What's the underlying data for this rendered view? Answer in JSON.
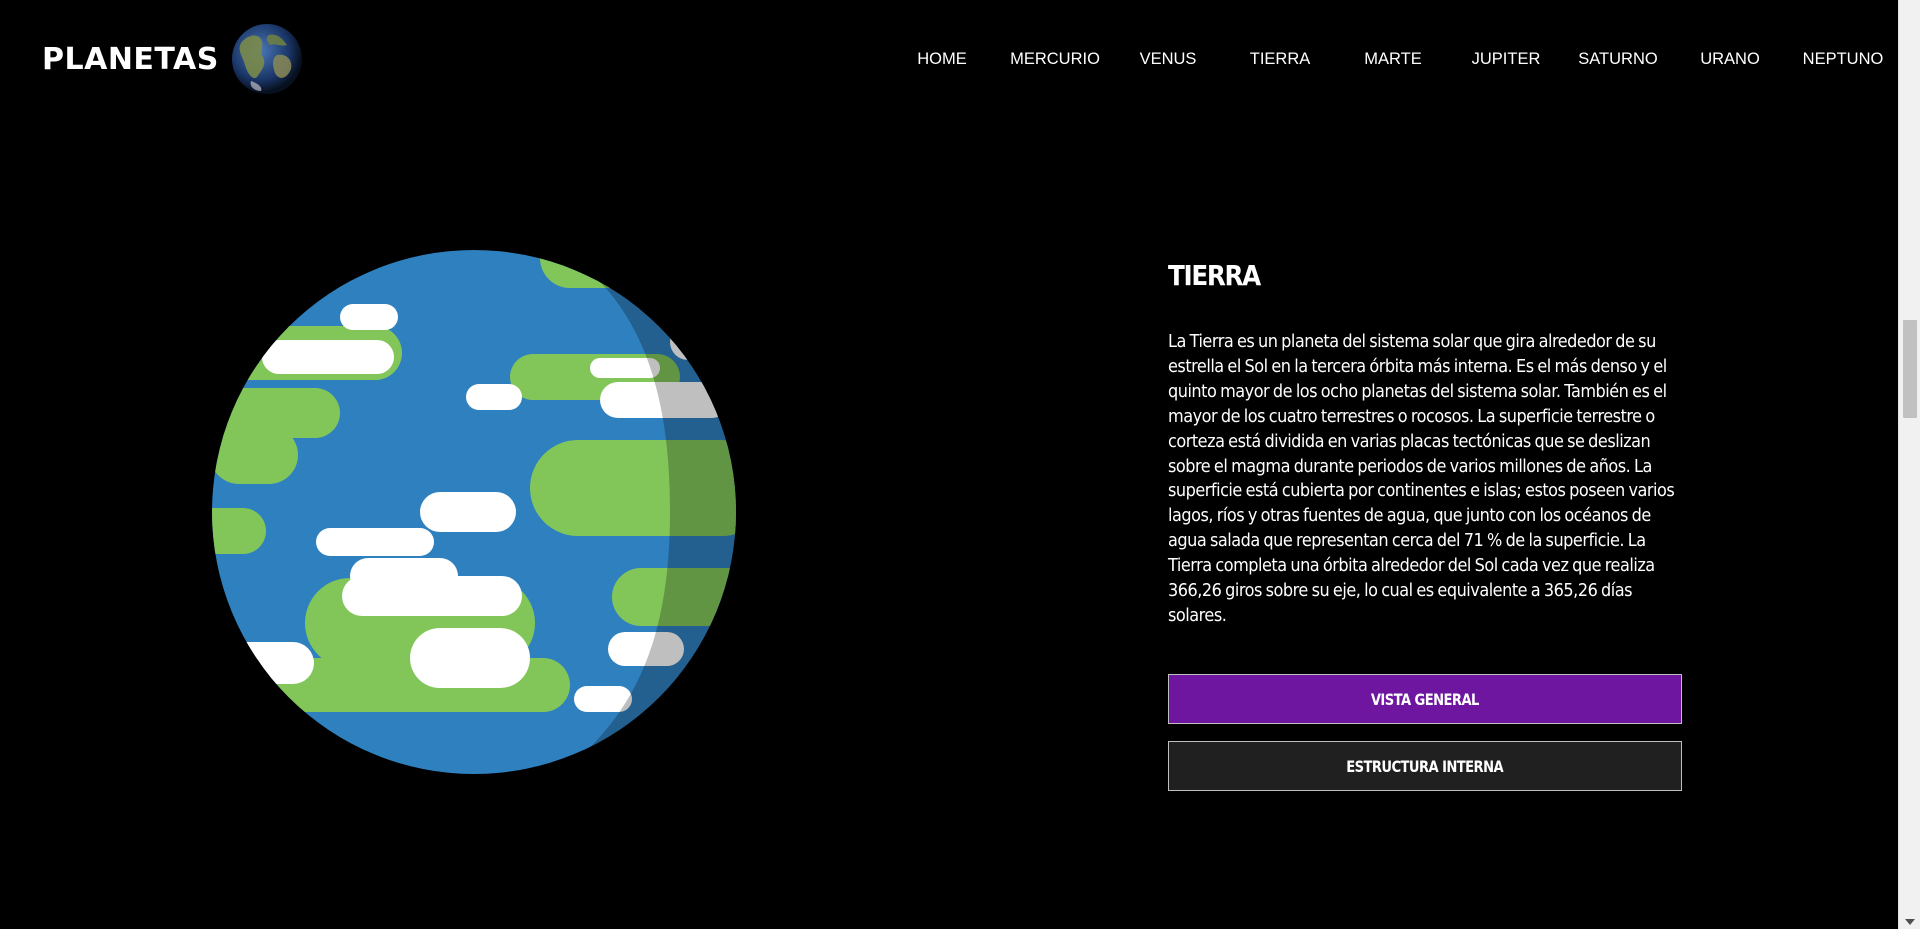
{
  "brand": {
    "title": "PLANETAS",
    "logo_icon": "earth-globe-icon"
  },
  "nav": {
    "items": [
      "HOME",
      "MERCURIO",
      "VENUS",
      "TIERRA",
      "MARTE",
      "JUPITER",
      "SATURNO",
      "URANO",
      "NEPTUNO"
    ]
  },
  "planet": {
    "name": "TIERRA",
    "description": "La Tierra es un planeta del sistema solar que gira alrededor de su estrella el Sol en la tercera órbita más interna. Es el más denso y el quinto mayor de los ocho planetas del sistema solar. También es el mayor de los cuatro terrestres o rocosos. La superficie terrestre o corteza está dividida en varias placas tectónicas que se deslizan sobre el magma durante periodos de varios millones de años. La superficie está cubierta por continentes e islas; estos poseen varios lagos, ríos y otras fuentes de agua, que junto con los océanos de agua salada que representan cerca del 71 % de la superficie. La Tierra completa una órbita alrededor del Sol cada vez que realiza 366,26 giros sobre su eje, lo cual es equivalente a 365,26 días solares.",
    "illustration_icon": "earth-planet-illustration"
  },
  "buttons": {
    "overview": "VISTA GENERAL",
    "structure": "ESTRUCTURA INTERNA"
  },
  "colors": {
    "background": "#000000",
    "ocean": "#2f80bf",
    "land": "#82c65a",
    "cloud": "#ffffff",
    "accent_button": "#6f16a0",
    "secondary_button": "#202020"
  }
}
